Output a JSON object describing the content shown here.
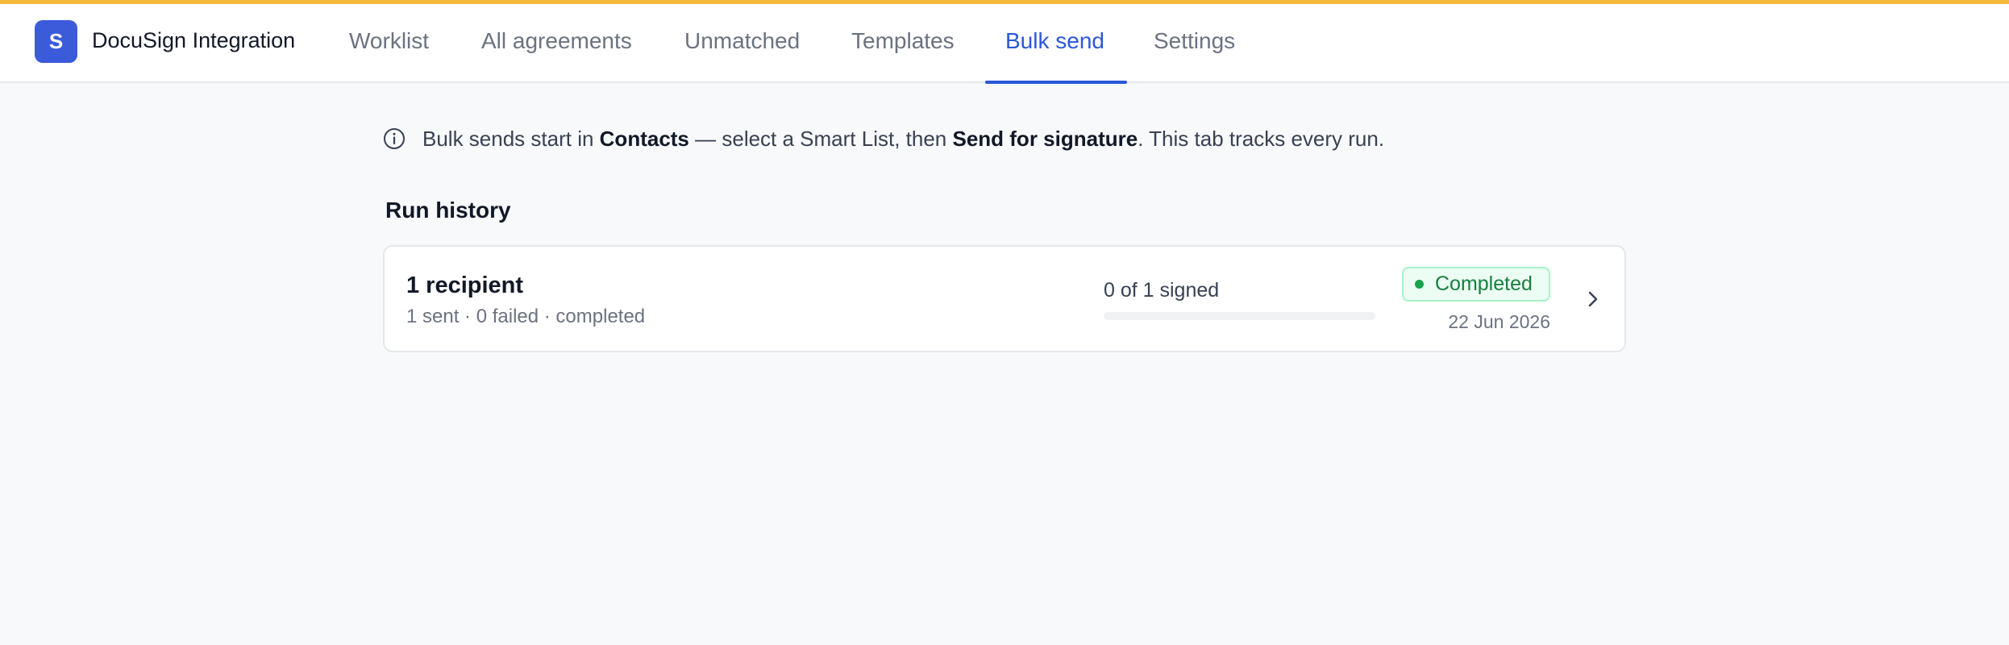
{
  "app": {
    "logo_letter": "S",
    "title": "DocuSign Integration"
  },
  "nav": {
    "tabs": [
      {
        "label": "Worklist"
      },
      {
        "label": "All agreements"
      },
      {
        "label": "Unmatched"
      },
      {
        "label": "Templates"
      },
      {
        "label": "Bulk send",
        "active": true
      },
      {
        "label": "Settings"
      }
    ]
  },
  "info": {
    "part1": "Bulk sends start in ",
    "bold1": "Contacts",
    "part2": " — select a Smart List, then ",
    "bold2": "Send for signature",
    "part3": ". This tab tracks every run.",
    "icon": "info-circle-icon"
  },
  "run_history": {
    "title": "Run history",
    "runs": [
      {
        "title": "1 recipient",
        "subtitle": "1 sent · 0 failed · completed",
        "signed_text": "0 of 1 signed",
        "percent_text": "0%",
        "progress": 0,
        "status": "Completed",
        "date": "22 Jun 2026"
      }
    ]
  },
  "colors": {
    "accent_bar": "#f5b93c",
    "brand": "#3b5bdb",
    "active_tab": "#2b57d9",
    "status_green": "#15803d"
  }
}
